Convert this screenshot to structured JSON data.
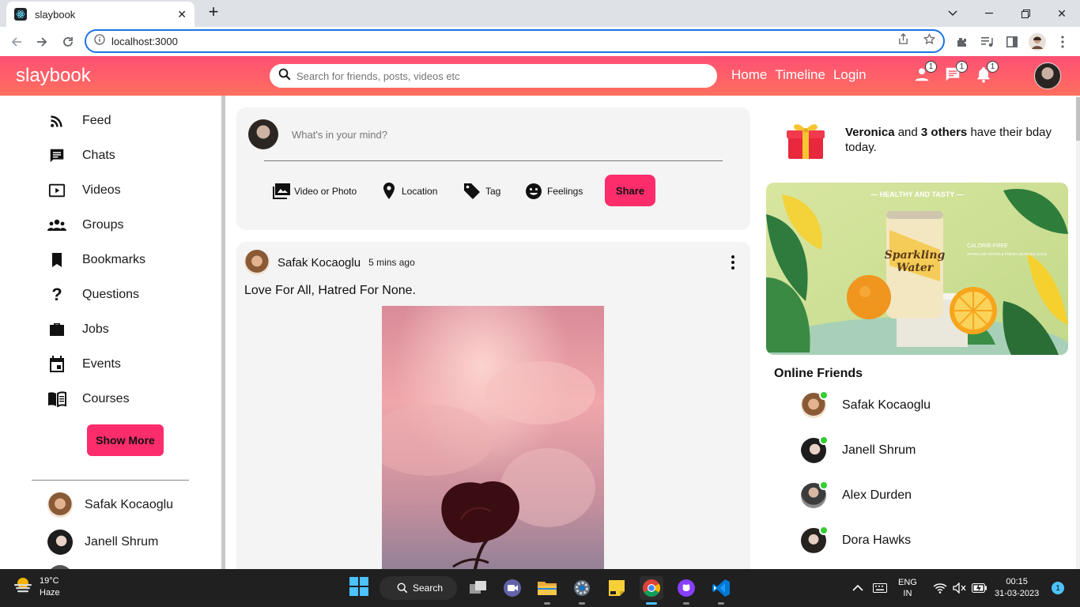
{
  "browser": {
    "tab_title": "slaybook",
    "url": "localhost:3000"
  },
  "app": {
    "logo": "slaybook",
    "search_placeholder": "Search for friends, posts, videos etc",
    "nav_links": [
      "Home",
      "Timeline",
      "Login"
    ],
    "badges": {
      "friends": "1",
      "messages": "1",
      "notifications": "1"
    },
    "accent": "#fd2d6c",
    "topbar_gradient": [
      "#fd5075",
      "#ff6f5e"
    ]
  },
  "sidebar": {
    "items": [
      {
        "label": "Feed",
        "icon": "rss-icon"
      },
      {
        "label": "Chats",
        "icon": "chat-icon"
      },
      {
        "label": "Videos",
        "icon": "video-icon"
      },
      {
        "label": "Groups",
        "icon": "groups-icon"
      },
      {
        "label": "Bookmarks",
        "icon": "bookmark-icon"
      },
      {
        "label": "Questions",
        "icon": "question-icon"
      },
      {
        "label": "Jobs",
        "icon": "briefcase-icon"
      },
      {
        "label": "Events",
        "icon": "calendar-icon"
      },
      {
        "label": "Courses",
        "icon": "book-icon"
      }
    ],
    "show_more": "Show More",
    "friends": [
      "Safak Kocaoglu",
      "Janell Shrum"
    ]
  },
  "share": {
    "prompt": "What's in your mind?",
    "options": [
      "Video or Photo",
      "Location",
      "Tag",
      "Feelings"
    ],
    "button": "Share"
  },
  "post": {
    "author": "Safak Kocaoglu",
    "time": "5 mins ago",
    "text": "Love For All, Hatred For None."
  },
  "rightbar": {
    "bday_name": "Veronica",
    "bday_middle": " and ",
    "bday_others": "3 others",
    "bday_suffix": " have their bday today.",
    "ad": {
      "headline": "— HEALTHY AND TASTY —",
      "can_label": "Sparkling Water",
      "side_title": "CALORIE-FREE",
      "side_sub": "SPARKLING WATER & FRESH ORANGES JUICE"
    },
    "online_title": "Online Friends",
    "online": [
      "Safak Kocaoglu",
      "Janell Shrum",
      "Alex Durden",
      "Dora Hawks"
    ],
    "online_color": "#32cd32"
  },
  "taskbar": {
    "temp": "19°C",
    "weather": "Haze",
    "search": "Search",
    "lang_1": "ENG",
    "lang_2": "IN",
    "time": "00:15",
    "date": "31-03-2023",
    "notifications": "1"
  }
}
